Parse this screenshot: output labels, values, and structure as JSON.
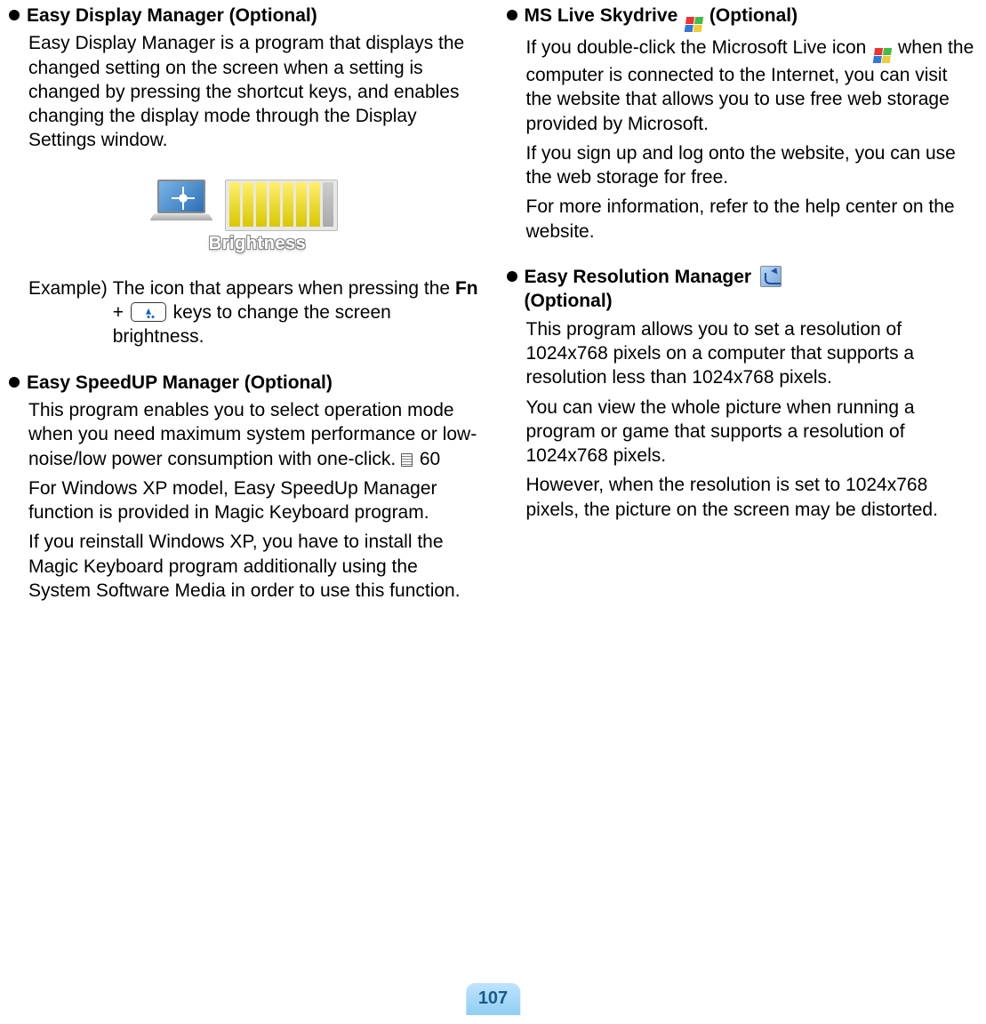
{
  "page_number": "107",
  "left": {
    "edm": {
      "title": "Easy Display Manager (Optional)",
      "desc": "Easy Display Manager is a program that displays the changed setting on the screen when a setting is changed by pressing the shortcut keys, and enables changing the display mode through the Display Settings window.",
      "widget_label": "Brightness",
      "example_lead": "Example)",
      "example_pre": "The icon that appears when pressing the ",
      "example_fn": "Fn",
      "example_plus": " + ",
      "example_post": " keys to change the screen brightness."
    },
    "speedup": {
      "title": "Easy SpeedUP Manager (Optional)",
      "p1_pre": "This program enables you to select operation mode when you need maximum system performance or low-noise/low power consumption with one-click. ",
      "pageref": "60",
      "p2": "For Windows XP model, Easy SpeedUp Manager function is provided in Magic Keyboard program.",
      "p3": "If you reinstall Windows XP, you have to install the Magic Keyboard program additionally using the System Software Media in order to use this function."
    }
  },
  "right": {
    "skydrive": {
      "title_pre": "MS Live Skydrive ",
      "title_post": " (Optional)",
      "p1_pre": "If you double-click the Microsoft Live icon ",
      "p1_post": " when the computer is connected to the Internet, you can visit the website that allows you to use free web storage provided by Microsoft.",
      "p2": "If you sign up and log onto the website, you can use the web storage for free.",
      "p3": "For more information, refer to the help center on the website."
    },
    "erm": {
      "title_pre": "Easy Resolution Manager ",
      "title_post": "(Optional)",
      "p1": "This program allows you to set a resolution of 1024x768 pixels on a computer that supports a resolution less than 1024x768 pixels.",
      "p2": "You can view the whole picture when running a program or game that supports a resolution of 1024x768 pixels.",
      "p3": "However, when the resolution is set to 1024x768 pixels, the picture on the screen may be distorted."
    }
  }
}
